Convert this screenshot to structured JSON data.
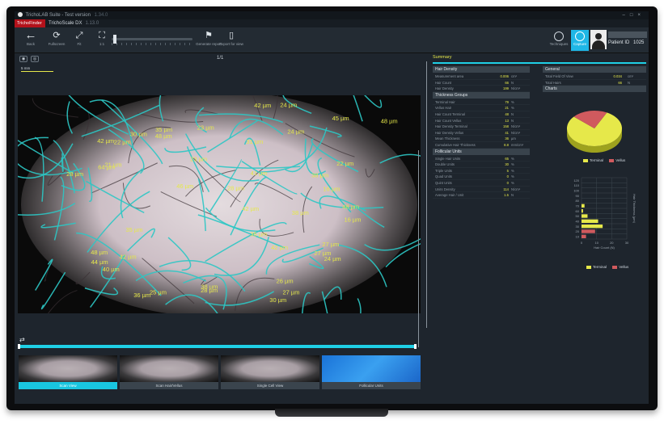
{
  "titlebar": {
    "title": "TrichoLAB Suite - Test version",
    "version": "1.34.0"
  },
  "tabs": {
    "brand": "TrichoFinder",
    "active": "TrichoScale DX",
    "version": "1.13.0"
  },
  "toolbar": {
    "back": "Back",
    "fullscreen": "Fullscreen",
    "tool3": "Fit",
    "tool4": "1:1",
    "generate_report": "Generate report",
    "export_for_view": "Export for view",
    "techniques": "Techniques",
    "capture": "Capture"
  },
  "patient": {
    "label": "Patient ID",
    "id": "1025"
  },
  "viewer": {
    "page": "1/1",
    "view_tab": "5 mm",
    "measurements": [
      "40 µm",
      "24 µm",
      "35 µm",
      "64 µm",
      "38 µm",
      "42 µm",
      "38 µm",
      "35 µm",
      "42 µm",
      "23 µm",
      "42 µm",
      "36 µm",
      "46 µm",
      "26 µm",
      "30 µm",
      "48 µm",
      "45 µm",
      "23 µm",
      "35 µm",
      "28 µm",
      "22 µm",
      "28 µm",
      "24 µm",
      "27 µm",
      "48 µm",
      "25 µm",
      "30 µm",
      "27 µm",
      "42 µm",
      "28 µm",
      "41 µm",
      "16 µm",
      "48 µm",
      "21 µm",
      "42 µm",
      "27 µm",
      "24 µm",
      "48 µm",
      "16 µm",
      "31 µm",
      "22 µm",
      "38 µm",
      "44 µm"
    ]
  },
  "thumbnails": [
    {
      "label": "Scan View"
    },
    {
      "label": "Scan Hair/Vellus"
    },
    {
      "label": "Single Cell View"
    },
    {
      "label": "Follicular Units"
    }
  ],
  "summary": {
    "title": "Summary",
    "hair_density": {
      "title": "Hair Density",
      "rows": [
        {
          "label": "Measurement area",
          "value": "0.006",
          "unit": "cm²"
        },
        {
          "label": "Hair Count",
          "value": "66",
          "unit": "N"
        },
        {
          "label": "Hair Density",
          "value": "199",
          "unit": "N/cm²"
        }
      ]
    },
    "thickness_groups": {
      "title": "Thickness Groups",
      "rows": [
        {
          "label": "Terminal Hair",
          "value": "79",
          "unit": "%"
        },
        {
          "label": "Vellus Hair",
          "value": "21",
          "unit": "%"
        },
        {
          "label": "Hair Count Terminal",
          "value": "48",
          "unit": "N"
        },
        {
          "label": "Hair Count Vellus",
          "value": "13",
          "unit": "N"
        },
        {
          "label": "Hair Density Terminal",
          "value": "158",
          "unit": "N/cm²"
        },
        {
          "label": "Hair Density Vellus",
          "value": "41",
          "unit": "N/cm²"
        },
        {
          "label": "Mean Thickness",
          "value": "36",
          "unit": "µm"
        },
        {
          "label": "Cumulative Hair Thickness",
          "value": "8.8",
          "unit": "mm/cm²"
        }
      ]
    },
    "follicular_units": {
      "title": "Follicular Units",
      "rows": [
        {
          "label": "Single Hair Units",
          "value": "65",
          "unit": "%"
        },
        {
          "label": "Double Units",
          "value": "30",
          "unit": "%"
        },
        {
          "label": "Triple Units",
          "value": "5",
          "unit": "%"
        },
        {
          "label": "Quad Units",
          "value": "0",
          "unit": "%"
        },
        {
          "label": "Quint Units",
          "value": "0",
          "unit": "%"
        },
        {
          "label": "Units Density",
          "value": "114",
          "unit": "N/cm²"
        },
        {
          "label": "Average Hair / Unit",
          "value": "1.5",
          "unit": "N"
        }
      ]
    },
    "general": {
      "title": "General",
      "rows": [
        {
          "label": "Total Field Of View",
          "value": "0.034",
          "unit": "cm²"
        },
        {
          "label": "Total Hairs",
          "value": "66",
          "unit": "N"
        }
      ]
    },
    "charts_title": "Charts"
  },
  "chart_data": [
    {
      "type": "pie",
      "labels": [
        "Terminal",
        "Vellus"
      ],
      "values": [
        79,
        21
      ],
      "colors": [
        "#e6e84a",
        "#d05a5e"
      ]
    },
    {
      "type": "bar",
      "orientation": "horizontal",
      "categories": [
        "10",
        "20",
        "30",
        "40",
        "50",
        "60",
        "70",
        "80",
        "90",
        "100",
        "110",
        "120"
      ],
      "series": [
        {
          "name": "Terminal",
          "values": [
            0,
            0,
            14,
            11,
            4,
            1,
            2,
            0,
            0,
            0,
            0,
            0
          ],
          "color": "#e6e84a"
        },
        {
          "name": "Vellus",
          "values": [
            3,
            9,
            0,
            0,
            0,
            0,
            0,
            0,
            0,
            0,
            0,
            0
          ],
          "color": "#d05a5e"
        }
      ],
      "xlabel": "Hair Count (N)",
      "ylabel": "Hair Thickness (µm)",
      "xticks": [
        "0",
        "10",
        "20",
        "30"
      ],
      "yticks": [
        "120",
        "110",
        "100",
        "90",
        "80",
        "70",
        "60",
        "50",
        "40",
        "30",
        "20",
        "10"
      ],
      "xlim": [
        0,
        30
      ]
    }
  ]
}
